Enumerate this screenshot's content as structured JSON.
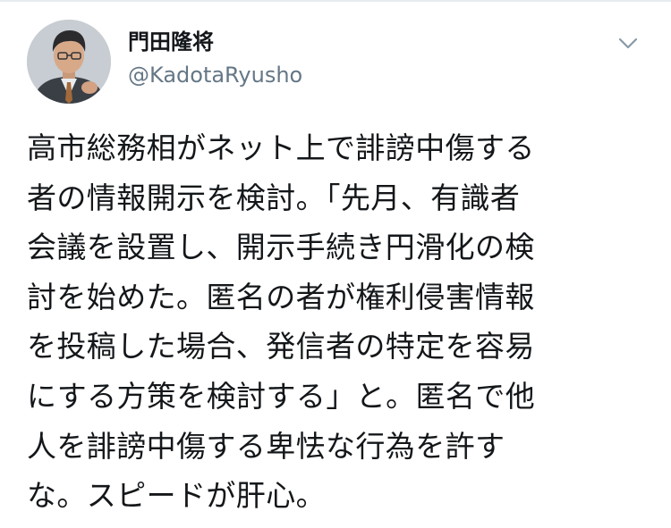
{
  "tweet": {
    "author": {
      "display_name": "門田隆将",
      "handle": "@KadotaRyusho"
    },
    "icons": {
      "menu": "chevron-down-icon",
      "avatar": "profile-photo"
    },
    "text": "高市総務相がネット上で誹謗中傷する\n者の情報開示を検討。「先月、有識者\n会議を設置し、開示手続き円滑化の検\n討を始めた。匿名の者が権利侵害情報\nを投稿した場合、発信者の特定を容易\nにする方策を検討する」と。匿名で他\n人を誹謗中傷する卑怯な行為を許す\nな。スピードが肝心。"
  },
  "colors": {
    "text": "#14171a",
    "secondary_text": "#657786",
    "divider": "#e6ecf0"
  }
}
